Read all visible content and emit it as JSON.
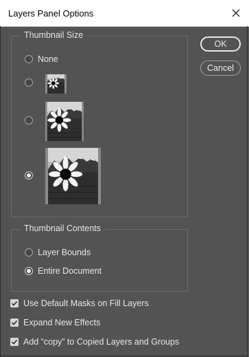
{
  "window": {
    "title": "Layers Panel Options"
  },
  "thumbnail_size": {
    "legend": "Thumbnail Size",
    "options": [
      {
        "label": "None",
        "checked": false
      },
      {
        "label": "",
        "size": "small",
        "checked": false
      },
      {
        "label": "",
        "size": "medium",
        "checked": false
      },
      {
        "label": "",
        "size": "large",
        "checked": true
      }
    ]
  },
  "thumbnail_contents": {
    "legend": "Thumbnail Contents",
    "options": [
      {
        "label": "Layer Bounds",
        "checked": false
      },
      {
        "label": "Entire Document",
        "checked": true
      }
    ]
  },
  "buttons": {
    "ok": "OK",
    "cancel": "Cancel"
  },
  "checkboxes": [
    {
      "label": "Use Default Masks on Fill Layers",
      "checked": true
    },
    {
      "label": "Expand New Effects",
      "checked": true
    },
    {
      "label": "Add “copy” to Copied Layers and Groups",
      "checked": true
    }
  ],
  "colors": {
    "dialog_bg": "#535353",
    "titlebar_bg": "#ffffff",
    "text": "#e6e6e6"
  }
}
